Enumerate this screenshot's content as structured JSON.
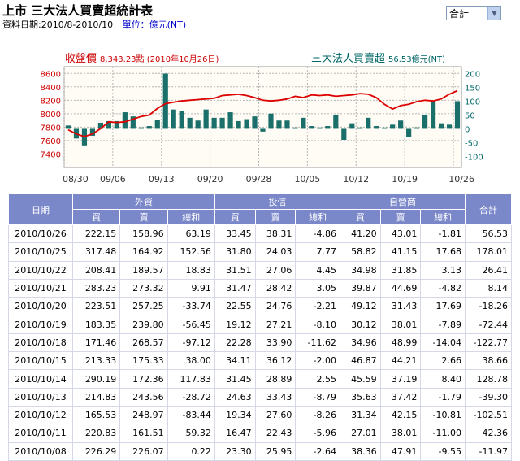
{
  "page": {
    "title": "上市 三大法人買賣超統計表",
    "date_range_label": "資料日期:2010/8-2010/10",
    "unit_label": "單位：億元(NT)",
    "market_select": "合計"
  },
  "legend": {
    "left_label": "收盤價",
    "left_value": "8,343.23點 (2010年10月26日)",
    "right_label": "三大法人買賣超",
    "right_value": "56.53億元(NT)"
  },
  "colors": {
    "line": "#dd0000",
    "bar": "#1a6f6a",
    "left_axis": "#cc0000",
    "right_axis": "#006666",
    "grid": "#b6b6b6",
    "plot_bg": "#fefcf4"
  },
  "chart_data": {
    "type": "bar+line",
    "x_tick_labels": [
      "08/30",
      "09/06",
      "09/13",
      "09/20",
      "09/28",
      "10/05",
      "10/12",
      "10/19",
      "10/26"
    ],
    "x_tick_index": [
      0,
      6,
      12,
      18,
      24,
      30,
      36,
      42,
      48
    ],
    "y_left_ticks": [
      7400,
      7600,
      7800,
      8000,
      8200,
      8400,
      8600
    ],
    "y_left_lim": [
      7200,
      8700
    ],
    "y_right_ticks": [
      -100,
      -50,
      0,
      50,
      100,
      150,
      200
    ],
    "y_right_lim": [
      -140,
      225
    ],
    "bars": [
      12,
      -35,
      -60,
      -25,
      22,
      28,
      28,
      60,
      45,
      5,
      10,
      33,
      200,
      70,
      65,
      40,
      30,
      70,
      40,
      40,
      60,
      28,
      35,
      45,
      -10,
      55,
      30,
      30,
      5,
      40,
      10,
      5,
      10,
      50,
      -40,
      20,
      5,
      40,
      10,
      5,
      15,
      30,
      -30,
      5,
      50,
      100,
      20,
      15,
      100
    ],
    "line": [
      7760,
      7700,
      7660,
      7700,
      7780,
      7880,
      7870,
      7880,
      7920,
      7960,
      7980,
      8080,
      8150,
      8170,
      8190,
      8200,
      8210,
      8220,
      8230,
      8270,
      8280,
      8290,
      8270,
      8240,
      8200,
      8190,
      8200,
      8220,
      8260,
      8240,
      8280,
      8270,
      8280,
      8260,
      8270,
      8280,
      8300,
      8290,
      8240,
      8140,
      8070,
      8120,
      8140,
      8180,
      8200,
      8190,
      8220,
      8290,
      8343
    ]
  },
  "table": {
    "headers": {
      "date": "日期",
      "foreign": "外資",
      "trust": "投信",
      "dealer": "自營商",
      "total": "合計",
      "buy": "買",
      "sell": "賣",
      "net": "總和"
    },
    "rows": [
      {
        "date": "2010/10/26",
        "f_buy": "222.15",
        "f_sell": "158.96",
        "f_net": "63.19",
        "t_buy": "33.45",
        "t_sell": "38.31",
        "t_net": "-4.86",
        "d_buy": "41.20",
        "d_sell": "43.01",
        "d_net": "-1.81",
        "total": "56.53"
      },
      {
        "date": "2010/10/25",
        "f_buy": "317.48",
        "f_sell": "164.92",
        "f_net": "152.56",
        "t_buy": "31.80",
        "t_sell": "24.03",
        "t_net": "7.77",
        "d_buy": "58.82",
        "d_sell": "41.15",
        "d_net": "17.68",
        "total": "178.01"
      },
      {
        "date": "2010/10/22",
        "f_buy": "208.41",
        "f_sell": "189.57",
        "f_net": "18.83",
        "t_buy": "31.51",
        "t_sell": "27.06",
        "t_net": "4.45",
        "d_buy": "34.98",
        "d_sell": "31.85",
        "d_net": "3.13",
        "total": "26.41"
      },
      {
        "date": "2010/10/21",
        "f_buy": "283.23",
        "f_sell": "273.32",
        "f_net": "9.91",
        "t_buy": "31.47",
        "t_sell": "28.42",
        "t_net": "3.05",
        "d_buy": "39.87",
        "d_sell": "44.69",
        "d_net": "-4.82",
        "total": "8.14"
      },
      {
        "date": "2010/10/20",
        "f_buy": "223.51",
        "f_sell": "257.25",
        "f_net": "-33.74",
        "t_buy": "22.55",
        "t_sell": "24.76",
        "t_net": "-2.21",
        "d_buy": "49.12",
        "d_sell": "31.43",
        "d_net": "17.69",
        "total": "-18.26"
      },
      {
        "date": "2010/10/19",
        "f_buy": "183.35",
        "f_sell": "239.80",
        "f_net": "-56.45",
        "t_buy": "19.12",
        "t_sell": "27.21",
        "t_net": "-8.10",
        "d_buy": "30.12",
        "d_sell": "38.01",
        "d_net": "-7.89",
        "total": "-72.44"
      },
      {
        "date": "2010/10/18",
        "f_buy": "171.46",
        "f_sell": "268.57",
        "f_net": "-97.12",
        "t_buy": "22.28",
        "t_sell": "33.90",
        "t_net": "-11.62",
        "d_buy": "34.96",
        "d_sell": "48.99",
        "d_net": "-14.04",
        "total": "-122.77"
      },
      {
        "date": "2010/10/15",
        "f_buy": "213.33",
        "f_sell": "175.33",
        "f_net": "38.00",
        "t_buy": "34.11",
        "t_sell": "36.12",
        "t_net": "-2.00",
        "d_buy": "46.87",
        "d_sell": "44.21",
        "d_net": "2.66",
        "total": "38.66"
      },
      {
        "date": "2010/10/14",
        "f_buy": "290.19",
        "f_sell": "172.36",
        "f_net": "117.83",
        "t_buy": "31.45",
        "t_sell": "28.89",
        "t_net": "2.55",
        "d_buy": "45.59",
        "d_sell": "37.19",
        "d_net": "8.40",
        "total": "128.78"
      },
      {
        "date": "2010/10/13",
        "f_buy": "214.83",
        "f_sell": "243.56",
        "f_net": "-28.72",
        "t_buy": "24.63",
        "t_sell": "33.43",
        "t_net": "-8.79",
        "d_buy": "35.63",
        "d_sell": "37.42",
        "d_net": "-1.79",
        "total": "-39.30"
      },
      {
        "date": "2010/10/12",
        "f_buy": "165.53",
        "f_sell": "248.97",
        "f_net": "-83.44",
        "t_buy": "19.34",
        "t_sell": "27.60",
        "t_net": "-8.26",
        "d_buy": "31.34",
        "d_sell": "42.15",
        "d_net": "-10.81",
        "total": "-102.51"
      },
      {
        "date": "2010/10/11",
        "f_buy": "220.83",
        "f_sell": "161.51",
        "f_net": "59.32",
        "t_buy": "16.47",
        "t_sell": "22.43",
        "t_net": "-5.96",
        "d_buy": "27.01",
        "d_sell": "38.01",
        "d_net": "-11.00",
        "total": "42.36"
      },
      {
        "date": "2010/10/08",
        "f_buy": "226.29",
        "f_sell": "226.07",
        "f_net": "0.22",
        "t_buy": "23.30",
        "t_sell": "25.95",
        "t_net": "-2.64",
        "d_buy": "38.36",
        "d_sell": "47.91",
        "d_net": "-9.55",
        "total": "-11.97"
      }
    ]
  }
}
